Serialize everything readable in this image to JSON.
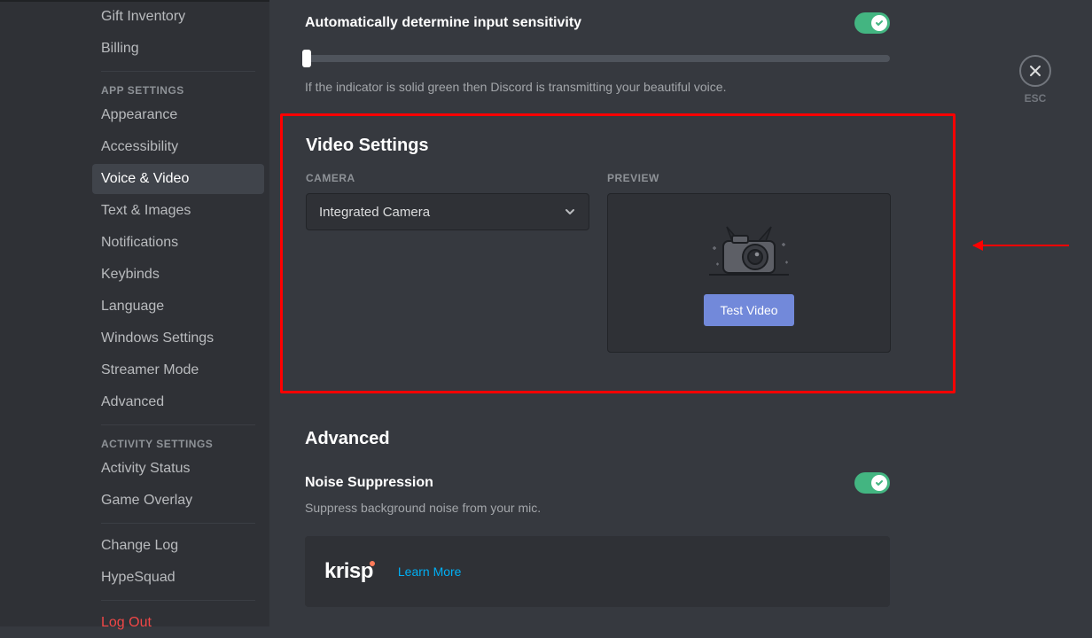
{
  "sidebar": {
    "header_user_items": [
      "Gift Inventory",
      "Billing"
    ],
    "app_header": "APP SETTINGS",
    "app_items": [
      "Appearance",
      "Accessibility",
      "Voice & Video",
      "Text & Images",
      "Notifications",
      "Keybinds",
      "Language",
      "Windows Settings",
      "Streamer Mode",
      "Advanced"
    ],
    "activity_header": "ACTIVITY SETTINGS",
    "activity_items": [
      "Activity Status",
      "Game Overlay"
    ],
    "footer_items": [
      "Change Log",
      "HypeSquad"
    ],
    "logout": "Log Out"
  },
  "close": {
    "esc": "ESC"
  },
  "input_sensitivity": {
    "label": "Automatically determine input sensitivity",
    "hint": "If the indicator is solid green then Discord is transmitting your beautiful voice."
  },
  "video": {
    "title": "Video Settings",
    "camera_label": "CAMERA",
    "camera_value": "Integrated Camera",
    "preview_label": "PREVIEW",
    "test_button": "Test Video"
  },
  "advanced": {
    "title": "Advanced",
    "noise_label": "Noise Suppression",
    "noise_hint": "Suppress background noise from your mic.",
    "krisp": "krisp",
    "learn_more": "Learn More"
  }
}
